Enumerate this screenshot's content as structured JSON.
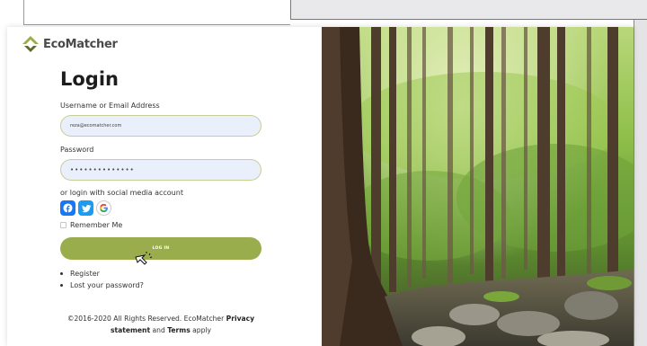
{
  "brand": {
    "name": "EcoMatcher"
  },
  "login": {
    "title": "Login",
    "username_label": "Username or Email Address",
    "username_value": "reza@ecomatcher.com",
    "password_label": "Password",
    "password_value": "••••••••••••••",
    "social_label": "or login with social media account",
    "social": [
      "facebook-icon",
      "twitter-icon",
      "google-icon"
    ],
    "remember_label": "Remember Me",
    "button_label": "LOG IN"
  },
  "links": {
    "register": "Register",
    "lost_password": "Lost your password?"
  },
  "footer": {
    "prefix": "©2016-2020 All Rights Reserved. EcoMatcher",
    "privacy": "Privacy",
    "statement": "statement",
    "and": "and",
    "terms": "Terms",
    "apply": "apply"
  },
  "colors": {
    "accent": "#9aad4d",
    "input_bg": "#e9effb",
    "facebook": "#1877f2",
    "twitter": "#1d9bf0"
  }
}
